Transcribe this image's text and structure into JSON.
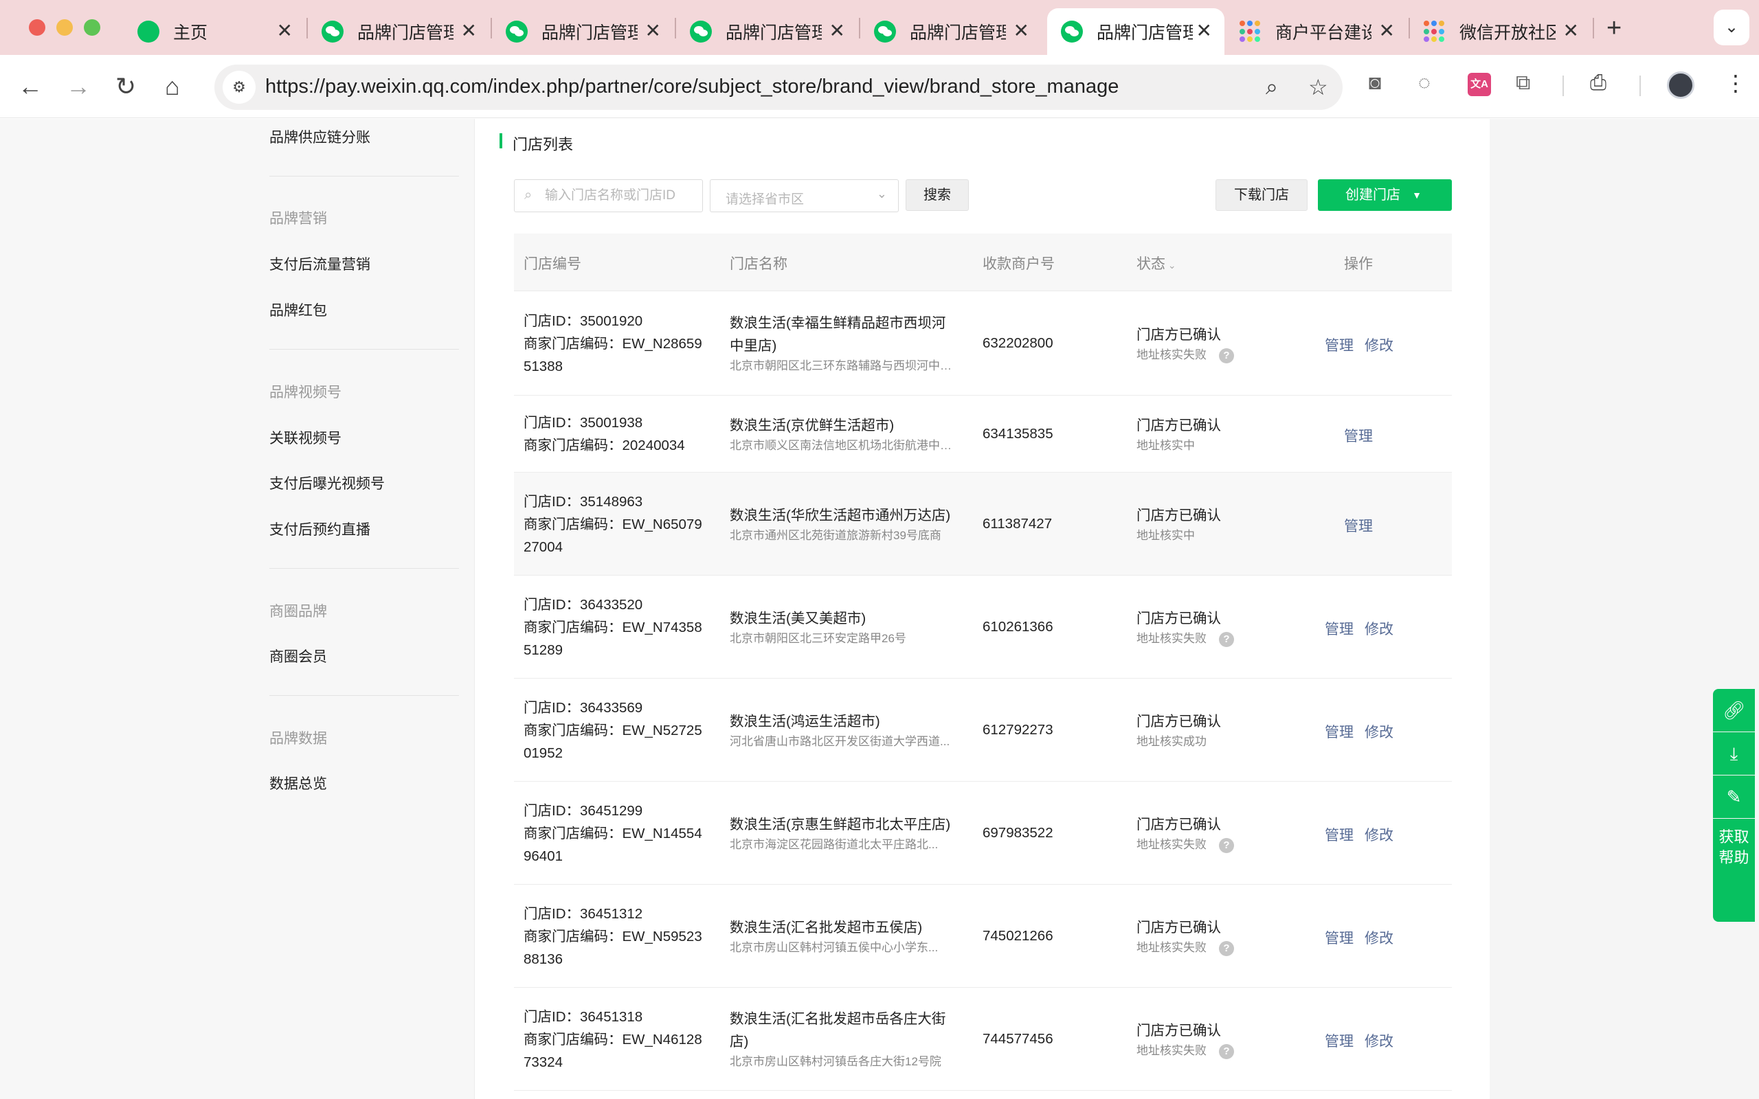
{
  "browser": {
    "tabs": [
      {
        "title": "主页",
        "icon": "home-icon"
      },
      {
        "title": "品牌门店管理",
        "icon": "wechat-icon"
      },
      {
        "title": "品牌门店管理",
        "icon": "wechat-icon"
      },
      {
        "title": "品牌门店管理",
        "icon": "wechat-icon"
      },
      {
        "title": "品牌门店管理",
        "icon": "wechat-icon"
      },
      {
        "title": "品牌门店管理",
        "icon": "wechat-icon",
        "active": true
      },
      {
        "title": "商户平台建设",
        "icon": "grid-icon"
      },
      {
        "title": "微信开放社区",
        "icon": "grid-icon"
      }
    ],
    "url": "https://pay.weixin.qq.com/index.php/partner/core/subject_store/brand_view/brand_store_manage",
    "new_tab_symbol": "+",
    "extension_translate_label": "文A"
  },
  "sidebar": {
    "items": [
      {
        "type": "item",
        "label": "品牌供应链分账"
      },
      {
        "type": "group",
        "label": "品牌营销"
      },
      {
        "type": "item",
        "label": "支付后流量营销"
      },
      {
        "type": "item",
        "label": "品牌红包"
      },
      {
        "type": "group",
        "label": "品牌视频号"
      },
      {
        "type": "item",
        "label": "关联视频号"
      },
      {
        "type": "item",
        "label": "支付后曝光视频号"
      },
      {
        "type": "item",
        "label": "支付后预约直播"
      },
      {
        "type": "group",
        "label": "商圈品牌"
      },
      {
        "type": "item",
        "label": "商圈会员"
      },
      {
        "type": "group",
        "label": "品牌数据"
      },
      {
        "type": "item",
        "label": "数据总览"
      }
    ]
  },
  "main": {
    "section_title": "门店列表",
    "search": {
      "placeholder": "输入门店名称或门店ID",
      "value": ""
    },
    "region_select": {
      "placeholder": "请选择省市区"
    },
    "search_button": "搜索",
    "download_button": "下载门店",
    "create_button": "创建门店",
    "table": {
      "headers": [
        "门店编号",
        "门店名称",
        "收款商户号",
        "状态",
        "操作"
      ],
      "rows": [
        {
          "store_id": "门店ID：35001920",
          "merchant_code_lines": [
            "商家门店编码：EW_N28659",
            "51388"
          ],
          "name_lines": [
            "数浪生活(幸福生鲜精品超市西坝河",
            "中里店)"
          ],
          "address": "北京市朝阳区北三环东路辅路与西坝河中里...",
          "merchant_no": "632202800",
          "status": "门店方已确认",
          "sub_status": "地址核实失败",
          "help": true,
          "ops": [
            "管理",
            "修改"
          ]
        },
        {
          "store_id": "门店ID：35001938",
          "merchant_code_lines": [
            "商家门店编码：20240034"
          ],
          "name_lines": [
            "数浪生活(京优鲜生活超市)"
          ],
          "address": "北京市顺义区南法信地区机场北街航港中心...",
          "merchant_no": "634135835",
          "status": "门店方已确认",
          "sub_status": "地址核实中",
          "help": false,
          "ops": [
            "管理"
          ]
        },
        {
          "store_id": "门店ID：35148963",
          "merchant_code_lines": [
            "商家门店编码：EW_N65079",
            "27004"
          ],
          "name_lines": [
            "数浪生活(华欣生活超市通州万达店)"
          ],
          "address": "北京市通州区北苑街道旅游新村39号底商",
          "merchant_no": "611387427",
          "status": "门店方已确认",
          "sub_status": "地址核实中",
          "help": false,
          "ops": [
            "管理"
          ]
        },
        {
          "store_id": "门店ID：36433520",
          "merchant_code_lines": [
            "商家门店编码：EW_N74358",
            "51289"
          ],
          "name_lines": [
            "数浪生活(美又美超市)"
          ],
          "address": "北京市朝阳区北三环安定路甲26号",
          "merchant_no": "610261366",
          "status": "门店方已确认",
          "sub_status": "地址核实失败",
          "help": true,
          "ops": [
            "管理",
            "修改"
          ]
        },
        {
          "store_id": "门店ID：36433569",
          "merchant_code_lines": [
            "商家门店编码：EW_N52725",
            "01952"
          ],
          "name_lines": [
            "数浪生活(鸿运生活超市)"
          ],
          "address": "河北省唐山市路北区开发区街道大学西道...",
          "merchant_no": "612792273",
          "status": "门店方已确认",
          "sub_status": "地址核实成功",
          "help": false,
          "ops": [
            "管理",
            "修改"
          ]
        },
        {
          "store_id": "门店ID：36451299",
          "merchant_code_lines": [
            "商家门店编码：EW_N14554",
            "96401"
          ],
          "name_lines": [
            "数浪生活(京惠生鲜超市北太平庄店)"
          ],
          "address": "北京市海淀区花园路街道北太平庄路北...",
          "merchant_no": "697983522",
          "status": "门店方已确认",
          "sub_status": "地址核实失败",
          "help": true,
          "ops": [
            "管理",
            "修改"
          ]
        },
        {
          "store_id": "门店ID：36451312",
          "merchant_code_lines": [
            "商家门店编码：EW_N59523",
            "88136"
          ],
          "name_lines": [
            "数浪生活(汇名批发超市五侯店)"
          ],
          "address": "北京市房山区韩村河镇五侯中心小学东...",
          "merchant_no": "745021266",
          "status": "门店方已确认",
          "sub_status": "地址核实失败",
          "help": true,
          "ops": [
            "管理",
            "修改"
          ]
        },
        {
          "store_id": "门店ID：36451318",
          "merchant_code_lines": [
            "商家门店编码：EW_N46128",
            "73324"
          ],
          "name_lines": [
            "数浪生活(汇名批发超市岳各庄大街",
            "店)"
          ],
          "address": "北京市房山区韩村河镇岳各庄大街12号院",
          "merchant_no": "744577456",
          "status": "门店方已确认",
          "sub_status": "地址核实失败",
          "help": true,
          "ops": [
            "管理",
            "修改"
          ]
        }
      ]
    }
  },
  "float_tools": {
    "help_label": "获取帮助",
    "icons": [
      "link-icon",
      "download-icon",
      "edit-icon"
    ]
  },
  "colors": {
    "accent": "#07c160",
    "link": "#576b95",
    "tabbar": "#f3d8da"
  }
}
